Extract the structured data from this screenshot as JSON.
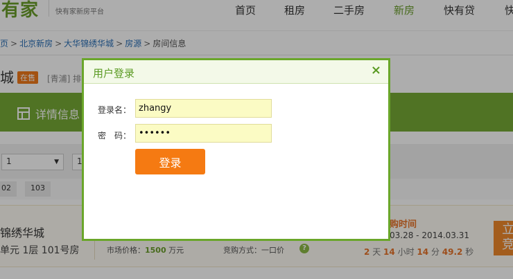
{
  "header": {
    "logo": "有家",
    "logo_sub": "快有家新房平台",
    "nav": [
      "首页",
      "租房",
      "二手房",
      "新房",
      "快有贷",
      "快"
    ]
  },
  "breadcrumb": {
    "items": [
      "首页",
      "北京新房",
      "大华锦绣华城",
      "房源"
    ],
    "separator": ">",
    "current": "房间信息"
  },
  "title": {
    "name": "城",
    "badge": "在售",
    "district": "[青浦] 排"
  },
  "tabs": {
    "detail": "详情信息"
  },
  "selects": {
    "first": "1",
    "second": "1"
  },
  "rooms": [
    "02",
    "103"
  ],
  "house": {
    "name": "锦绣华城",
    "unit": "单元 1层 101号房",
    "market_label": "市场价格：",
    "market_value": "1500",
    "market_unit": "万元",
    "bid_way": "竞购方式：一口价",
    "help": "?",
    "bid_time_label": "购时间",
    "bid_time_range": "03.28 - 2014.03.31",
    "countdown": {
      "days": "2",
      "days_unit": "天",
      "hours": "14",
      "hours_unit": "小时",
      "minutes": "14",
      "minutes_unit": "分",
      "seconds": "49.2",
      "seconds_unit": "秒"
    },
    "bid_button": "立竞"
  },
  "dialog": {
    "title": "用户登录",
    "close": "×",
    "username_label": "登录名：",
    "username_value": "zhangy",
    "password_label": "密　码：",
    "password_value": "123456",
    "submit": "登录"
  },
  "colors": {
    "brand_green": "#77aa36",
    "accent_orange": "#f57a12",
    "link_blue": "#2a6fb6"
  }
}
